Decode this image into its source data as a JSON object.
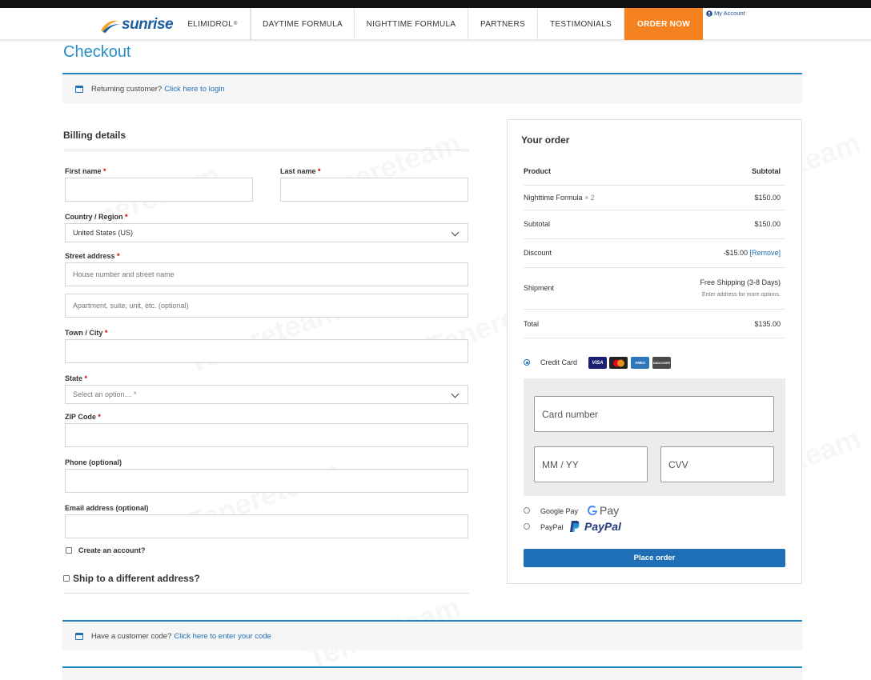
{
  "header": {
    "logo_text": "sunrise",
    "nav": [
      {
        "label": "ELIMIDROL",
        "sup": "®"
      },
      {
        "label": "DAYTIME FORMULA"
      },
      {
        "label": "NIGHTTIME FORMULA"
      },
      {
        "label": "PARTNERS"
      },
      {
        "label": "TESTIMONIALS"
      },
      {
        "label": "ORDER NOW"
      }
    ],
    "my_account": "My Account"
  },
  "page_title": "Checkout",
  "returning_notice": {
    "text": "Returning customer?",
    "link": "Click here to login"
  },
  "billing": {
    "title": "Billing details",
    "first_name": {
      "label": "First name",
      "req": "*"
    },
    "last_name": {
      "label": "Last name",
      "req": "*"
    },
    "country": {
      "label": "Country / Region",
      "req": "*",
      "value": "United States (US)"
    },
    "street": {
      "label": "Street address",
      "req": "*",
      "placeholder1": "House number and street name",
      "placeholder2": "Apartment, suite, unit, etc. (optional)"
    },
    "city": {
      "label": "Town / City",
      "req": "*"
    },
    "state": {
      "label": "State",
      "req": "*",
      "placeholder": "Select an option… *"
    },
    "zip": {
      "label": "ZIP Code",
      "req": "*"
    },
    "phone": {
      "label": "Phone (optional)"
    },
    "email": {
      "label": "Email address (optional)"
    },
    "create_account": "Create an account?",
    "ship_different": "Ship to a different address?"
  },
  "order": {
    "title": "Your order",
    "col_product": "Product",
    "col_subtotal": "Subtotal",
    "item_name": "Nighttime Formula",
    "item_qty": "× 2",
    "item_price": "$150.00",
    "subtotal_label": "Subtotal",
    "subtotal_value": "$150.00",
    "discount_label": "Discount",
    "discount_value": "-$15.00",
    "discount_remove": "[Remove]",
    "shipment_label": "Shipment",
    "shipment_value": "Free Shipping (3-8 Days)",
    "shipment_note": "Enter address for more options.",
    "total_label": "Total",
    "total_value": "$135.00"
  },
  "payment": {
    "credit_card": "Credit Card",
    "card_logos": [
      "VISA",
      "MC",
      "AMEX",
      "DISCOVER"
    ],
    "card_number_placeholder": "Card number",
    "expiry_placeholder": "MM / YY",
    "cvv_placeholder": "CVV",
    "google_pay": "Google Pay",
    "google_pay_logo": "Pay",
    "paypal": "PayPal",
    "paypal_logo": "PayPal",
    "place_order": "Place order"
  },
  "coupon_notice": {
    "text": "Have a customer code?",
    "link": "Click here to enter your code"
  },
  "watermark": "Tenereteam",
  "colors": {
    "accent": "#1e6fb5",
    "order_now": "#f58220",
    "title": "#2a8fc4"
  }
}
